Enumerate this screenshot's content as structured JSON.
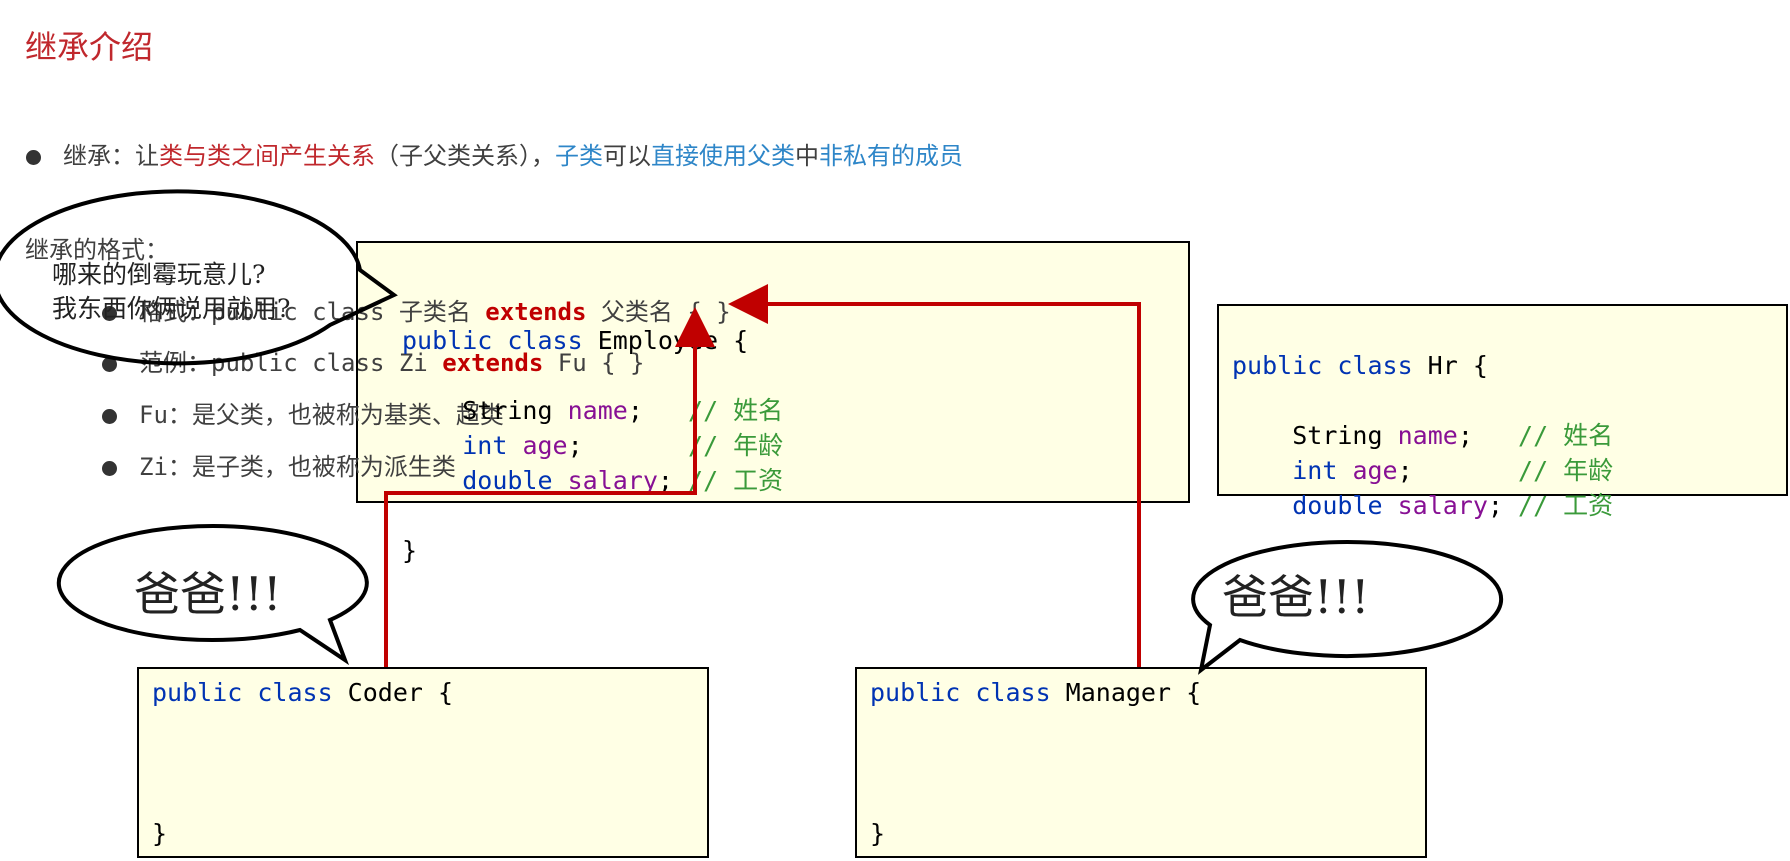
{
  "title": "继承介绍",
  "intro": {
    "segments": [
      {
        "text": "继承：让",
        "color": "#404040"
      },
      {
        "text": "类与类之间产生关系",
        "color": "#c0282d"
      },
      {
        "text": "（子父类关系），",
        "color": "#404040"
      },
      {
        "text": "子类",
        "color": "#2e86c8"
      },
      {
        "text": "可以",
        "color": "#404040"
      },
      {
        "text": "直接使用父类",
        "color": "#2e86c8"
      },
      {
        "text": "中",
        "color": "#404040"
      },
      {
        "text": "非私有的成员",
        "color": "#2e86c8"
      }
    ]
  },
  "format": {
    "heading": "继承的格式：",
    "bullets": [
      {
        "pre": "格式：public class 子类名 ",
        "ext": "extends",
        "post": " 父类名 { }"
      },
      {
        "pre": "范例：public class Zi ",
        "ext": "extends",
        "post": " Fu { }"
      },
      {
        "pre": "Fu：是父类，也被称为基类、超类",
        "ext": "",
        "post": ""
      },
      {
        "pre": "Zi：是子类，也被称为派生类",
        "ext": "",
        "post": ""
      }
    ]
  },
  "top_bubble": {
    "line1": "哪来的倒霉玩意儿?",
    "line2": "我东西你俩说用就用?"
  },
  "employee": {
    "kw": "public class",
    "name": " Employee {",
    "close": "}",
    "fields": [
      {
        "type": "String",
        "name": "name",
        "pad": ";   ",
        "comment": "// 姓名"
      },
      {
        "type": "int",
        "name": "age",
        "pad": ";       ",
        "comment": "// 年龄"
      },
      {
        "type": "double",
        "name": "salary",
        "pad": "; ",
        "comment": "// 工资"
      }
    ]
  },
  "hr": {
    "kw": "public class",
    "name": " Hr {",
    "close": "}",
    "fields": [
      {
        "type": "String",
        "name": "name",
        "pad": ";   ",
        "comment": "// 姓名"
      },
      {
        "type": "int",
        "name": "age",
        "pad": ";       ",
        "comment": "// 年龄"
      },
      {
        "type": "double",
        "name": "salary",
        "pad": "; ",
        "comment": "// 工资"
      }
    ]
  },
  "coder": {
    "kw": "public class",
    "name": " Coder {",
    "close": "}"
  },
  "manager": {
    "kw": "public class",
    "name": " Manager {",
    "close": "}"
  },
  "coder_bubble": "爸爸!!!",
  "manager_bubble": "爸爸!!!",
  "colors": {
    "title": "#c0282d",
    "arrow": "#c00000",
    "box_bg": "#ffffe5",
    "keyword": "#0033b3",
    "field": "#871094",
    "comment": "#3a9a3a"
  }
}
